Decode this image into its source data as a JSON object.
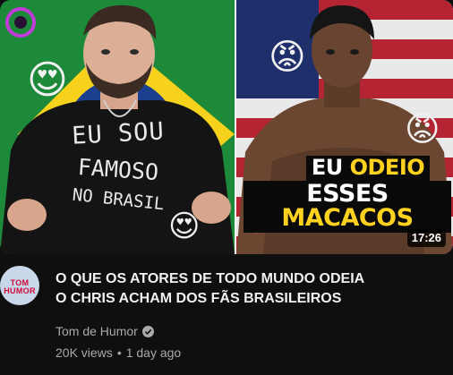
{
  "video": {
    "title_line1": "O QUE OS ATORES DE TODO MUNDO ODEIA",
    "title_line2": "O CHRIS ACHAM DOS FÃS BRASILEIROS",
    "duration": "17:26",
    "channel": "Tom de Humor",
    "views": "20K views",
    "separator": "•",
    "age": "1 day ago"
  },
  "thumbnail": {
    "shirt_line1": "EU SOU",
    "shirt_line2": "FAMOSO",
    "shirt_line3": "NO BRASIL",
    "caption_word1": "EU",
    "caption_word2": "ODEIO",
    "caption_word3": "ESSES",
    "caption_word4": "MACACOS",
    "emoji_love": "😍",
    "emoji_angry": "😡"
  },
  "avatar": {
    "text_top": "TOM",
    "text_bottom": "HUMOR"
  },
  "colors": {
    "background": "#0f0f0f",
    "title": "#f1f1f1",
    "meta": "#aaaaaa",
    "caption_highlight": "#ffd21f",
    "brazil_green": "#1d8a3a",
    "brazil_yellow": "#f6d21c",
    "brazil_blue": "#1c3f8f",
    "usa_red": "#b52433"
  }
}
